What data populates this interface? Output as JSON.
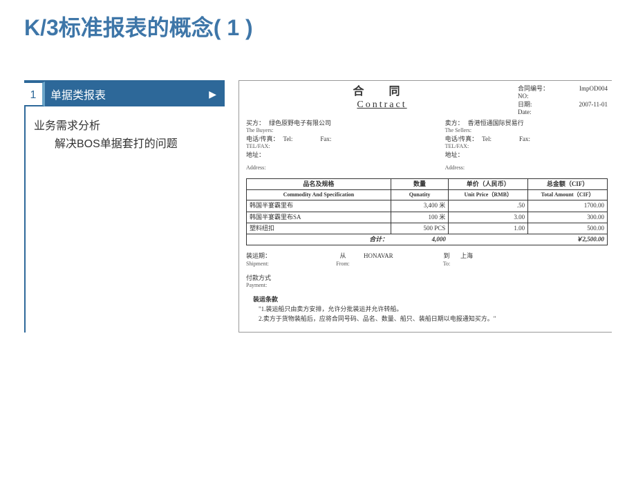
{
  "page": {
    "title": "K/3标准报表的概念( 1 )"
  },
  "tab": {
    "num": "1",
    "label": "单据类报表",
    "arrow": "▶"
  },
  "analysis": {
    "line1": "业务需求分析",
    "line2": "解决BOS单据套打的问题"
  },
  "doc": {
    "title_cn": "合 同",
    "title_en": "Contract",
    "head_right": {
      "contract_no_label": "合同编号：",
      "contract_no_val": "ImpOD004",
      "no_label": "NO:",
      "date_label": "日期:",
      "date_val": "2007-11-01",
      "date_en": "Date:"
    },
    "buyer": {
      "label_cn": "买方：",
      "val_cn": "绿色原野电子有限公司",
      "label_en": "The Buyers:",
      "tel_label": "电话/传真：",
      "tel": "Tel:",
      "fax": "Fax:",
      "telfax_en": "TEL/FAX:",
      "addr_label": "地址：",
      "addr_en": "Address:"
    },
    "seller": {
      "label_cn": "卖方：",
      "val_cn": "香港恒通国际贸易行",
      "label_en": "The Sellers:",
      "tel_label": "电话/传真：",
      "tel": "Tel:",
      "fax": "Fax:",
      "telfax_en": "TEL/FAX:",
      "addr_label": "地址：",
      "addr_en": "Address:"
    },
    "headers": {
      "col1_cn": "品名及规格",
      "col2_cn": "数量",
      "col3_cn": "单价（人民币）",
      "col4_cn": "总金额（CIF）",
      "col1_en": "Commodity And Specification",
      "col2_en": "Qunatity",
      "col3_en": "Unit Price（RMB）",
      "col4_en": "Total Amount（CIF）"
    },
    "rows": [
      {
        "name": "韩国半宴霸里布",
        "qty": "3,400 米",
        "price": ".50",
        "total": "1700.00"
      },
      {
        "name": "韩国半宴霸里布SA",
        "qty": "100 米",
        "price": "3.00",
        "total": "300.00"
      },
      {
        "name": "塑料纽扣",
        "qty": "500 PCS",
        "price": "1.00",
        "total": "500.00"
      }
    ],
    "total": {
      "label": "合计：",
      "qty": "4,000",
      "amount": "￥2,500.00"
    },
    "ship": {
      "date_cn": "装运期：",
      "date_en": "Shipment:",
      "from_cn": "从",
      "from_en": "From:",
      "from_val": "HONAVAR",
      "to_cn": "到",
      "to_en": "To:",
      "to_val": "上海"
    },
    "pay": {
      "label_cn": "付款方式",
      "label_en": "Payment:"
    },
    "terms_title": "装运条款",
    "terms": {
      "l1": "\"1.装运船只由卖方安排，允许分批装运并允许转船。",
      "l2": "2.卖方于货物装船后，应将合同号码、品名、数量、船只、装船日期以电报通知买方。\""
    }
  }
}
